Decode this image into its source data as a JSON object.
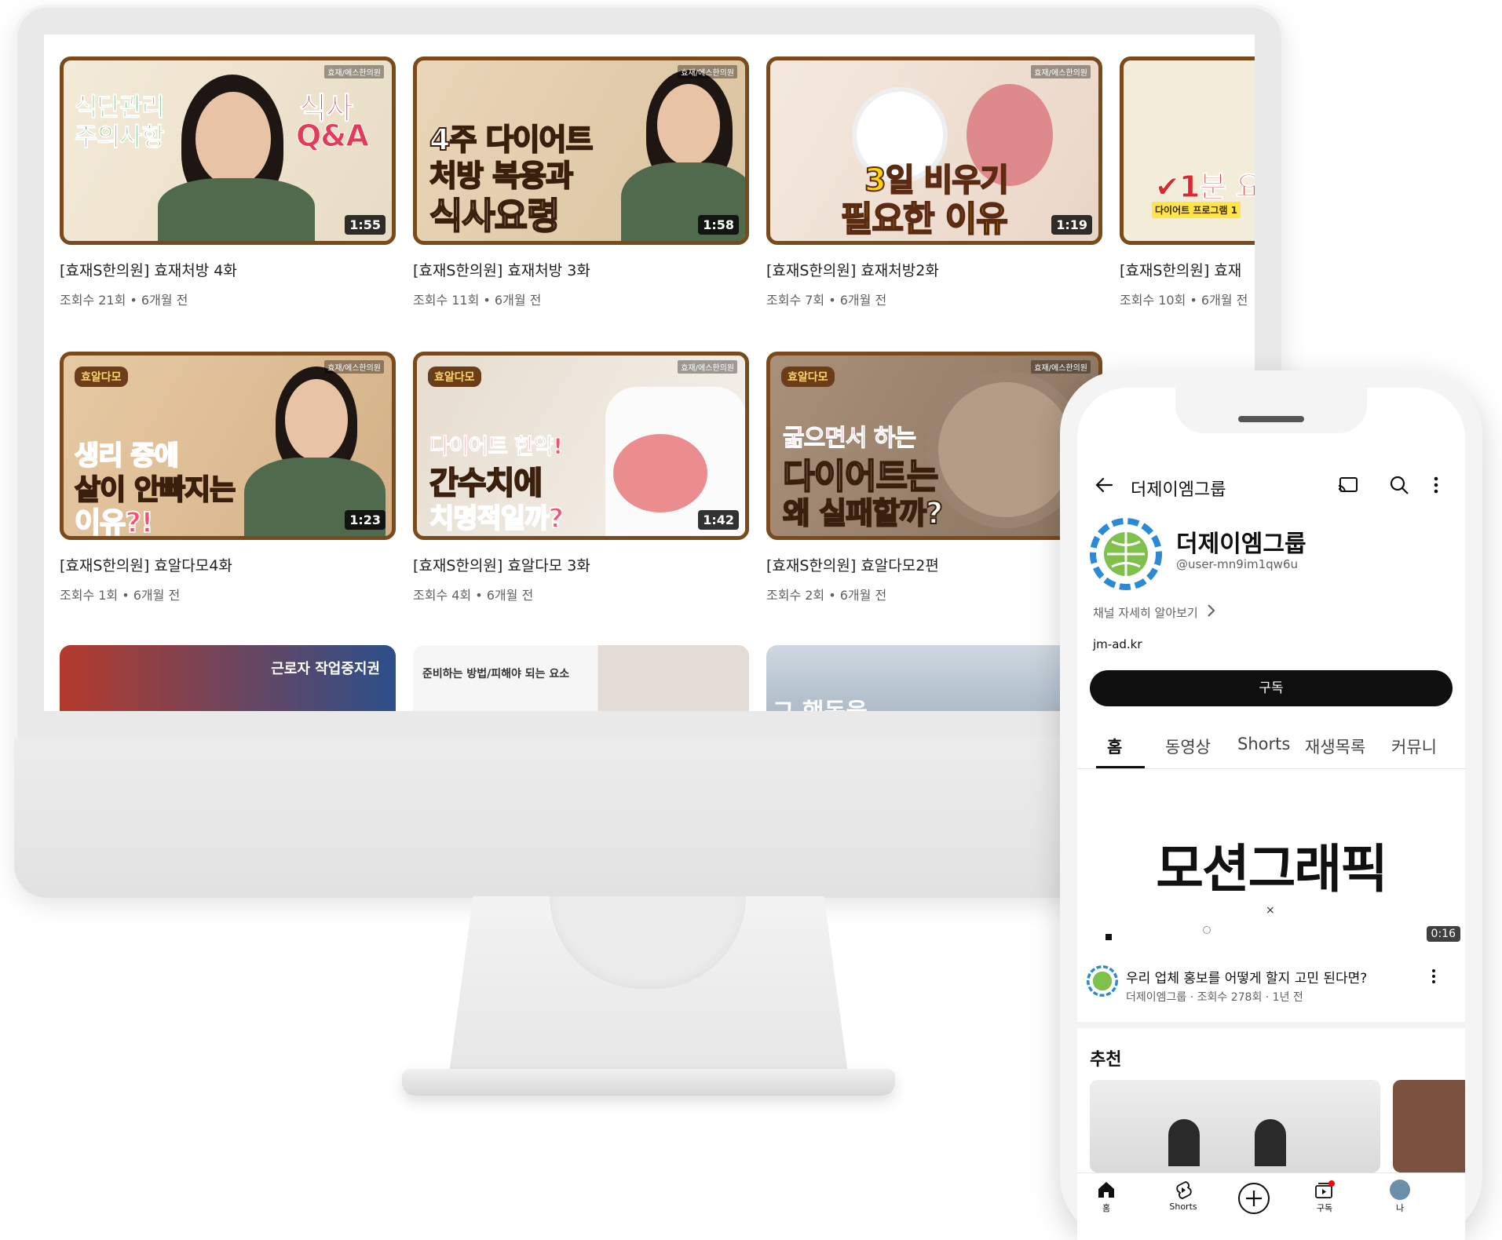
{
  "desktop": {
    "videos": [
      {
        "title": "[효재S한의원] 효재처방 4화",
        "meta": "조회수 21회 • 6개월 전",
        "duration": "1:55",
        "thumb_text_1": "식단관리",
        "thumb_text_2": "주의사항",
        "thumb_text_3": "식사",
        "thumb_text_4": "Q&A",
        "tag": "효재/에스한의원"
      },
      {
        "title": "[효재S한의원] 효재처방 3화",
        "meta": "조회수 11회 • 6개월 전",
        "duration": "1:58",
        "thumb_text_1": "4주 다이어트",
        "thumb_text_2": "처방 복용과",
        "thumb_text_3": "식사요령",
        "tag": "효재/에스한의원"
      },
      {
        "title": "[효재S한의원] 효재처방2화",
        "meta": "조회수 7회 • 6개월 전",
        "duration": "1:19",
        "thumb_text_1": "3일 비우기",
        "thumb_text_2": "필요한 이유",
        "tag": "효재/에스한의원"
      },
      {
        "title": "[효재S한의원] 효재",
        "meta": "조회수 10회 • 6개월 전",
        "thumb_text_1": "✔1분 요",
        "thumb_text_2": "다이어트 프로그램 1"
      },
      {
        "title": "[효재S한의원] 효알다모4화",
        "meta": "조회수 1회 • 6개월 전",
        "duration": "1:23",
        "thumb_text_1": "생리 중에",
        "thumb_text_2": "살이 안빠지는",
        "thumb_text_3": "이유?!",
        "badge": "효알다모",
        "tag": "효재/에스한의원"
      },
      {
        "title": "[효재S한의원] 효알다모 3화",
        "meta": "조회수 4회 • 6개월 전",
        "duration": "1:42",
        "thumb_text_1": "다이어트 한약!",
        "thumb_text_2": "간수치에",
        "thumb_text_3": "치명적일까?",
        "badge": "효알다모",
        "tag": "효재/에스한의원"
      },
      {
        "title": "[효재S한의원] 효알다모2편",
        "meta": "조회수 2회 • 6개월 전",
        "thumb_text_1": "굶으면서 하는",
        "thumb_text_2": "다이어트는",
        "thumb_text_3": "왜 실패할까?",
        "badge": "효알다모",
        "tag": "효재/에스한의원"
      }
    ],
    "row3": [
      {
        "thumb_text": "근로자 작업중지권"
      },
      {
        "thumb_text": "준비하는 방법/피해야 되는 요소"
      },
      {
        "thumb_text": "그 행동을"
      }
    ]
  },
  "phone": {
    "topbar_title": "더제이엠그룹",
    "channel_name": "더제이엠그룹",
    "handle": "@user-mn9im1qw6u",
    "more_link": "채널 자세히 알아보기",
    "website": "jm-ad.kr",
    "subscribe_label": "구독",
    "tabs": [
      "홈",
      "동영상",
      "Shorts",
      "재생목록",
      "커뮤니"
    ],
    "featured_text": "모션그래픽",
    "featured_duration": "0:16",
    "featured_title": "우리 업체 홍보를 어떻게 할지 고민 된다면?",
    "featured_meta": "더제이엠그룹 · 조회수 278회 · 1년 전",
    "section_title": "추천",
    "nav": {
      "home": "홈",
      "shorts": "Shorts",
      "subs": "구독",
      "me": "나"
    }
  },
  "colors": {
    "thumb_border": "#7a4a1c",
    "subscribe_bg": "#0f0f0f",
    "notification_dot": "#ff0000"
  }
}
